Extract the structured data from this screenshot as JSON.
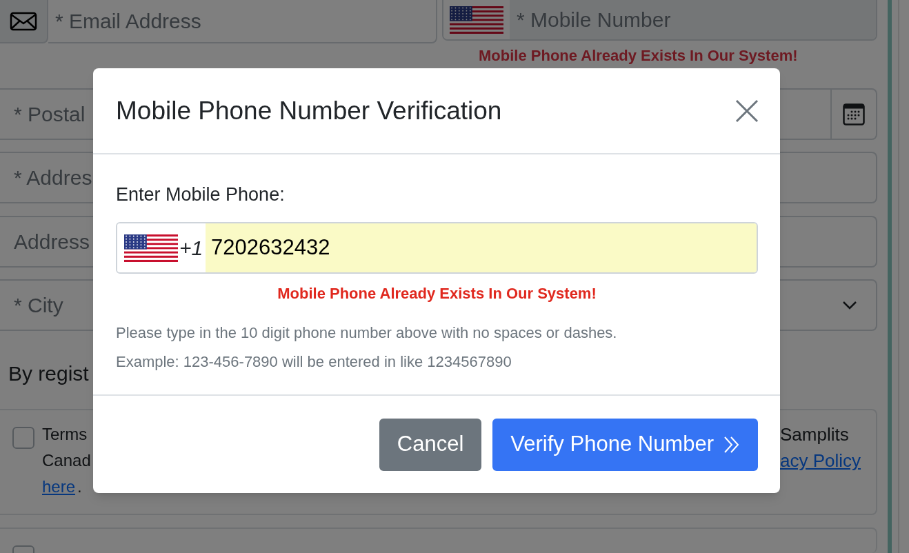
{
  "background_form": {
    "email": {
      "placeholder": "* Email Address"
    },
    "mobile": {
      "placeholder": "* Mobile Number",
      "error": "Mobile Phone Already Exists In Our System!"
    },
    "fields": [
      {
        "kind": "date",
        "placeholder": "* Postal"
      },
      {
        "kind": "text",
        "placeholder": "* Addres"
      },
      {
        "kind": "text",
        "placeholder": "Address"
      },
      {
        "kind": "select",
        "placeholder": "* City"
      }
    ],
    "consent_heading": "By regist",
    "agreements": [
      {
        "checked": false,
        "left_lines": [
          "Terms",
          "Canad"
        ],
        "left_link": "here",
        "after_link": ".",
        "right_text": "Samplits",
        "right_link": "acy Policy"
      },
      {
        "checked": false
      }
    ]
  },
  "modal": {
    "title": "Mobile Phone Number Verification",
    "label": "Enter Mobile Phone:",
    "phone": {
      "country_code": "+1",
      "value": "7202632432"
    },
    "error": "Mobile Phone Already Exists In Our System!",
    "help": [
      "Please type in the 10 digit phone number above with no spaces or dashes.",
      "Example: 123-456-7890 will be entered in like 1234567890"
    ],
    "buttons": [
      {
        "kind": "secondary",
        "label": "Cancel"
      },
      {
        "kind": "primary",
        "label": "Verify Phone Number"
      }
    ]
  }
}
